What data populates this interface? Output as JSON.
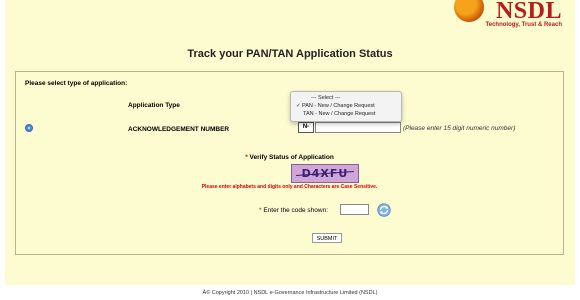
{
  "header": {
    "logo_text": "NSDL",
    "logo_tagline": "Technology, Trust & Reach"
  },
  "page": {
    "title": "Track your PAN/TAN Application Status"
  },
  "form": {
    "section_label": "Please select type of application:",
    "application_type_label": "Application Type",
    "application_type_options": [
      "--- Select ---",
      "PAN - New / Change Request",
      "TAN - New / Change Request"
    ],
    "selected_check": "✓",
    "ack_label": "ACKNOWLEDGEMENT NUMBER",
    "ack_prefix": "N-",
    "ack_value": "",
    "ack_hint": "(Please enter 15 digit numeric number)",
    "verify_star": "*",
    "verify_title": "Verify Status of Application",
    "captcha_text": "D4XFU",
    "captcha_note": "Please enter alphabets and digits only and Characters are Case Sensitive.",
    "code_star": "*",
    "code_label": "Enter the code shown:",
    "code_value": "",
    "submit_label": "SUBMIT"
  },
  "footer": {
    "copyright": "Â© Copyright 2010  |  NSDL e-Governance Infrastructure Limited (NSDL)"
  },
  "colors": {
    "page_background": "#fdfbd0",
    "brand_red": "#b81c1c",
    "required_red": "#dd0000",
    "captcha_background": "#cfa6d8"
  },
  "icons": {
    "logo": "nsdl-emblem-icon",
    "refresh": "refresh-icon",
    "radio": "radio-selected-icon"
  }
}
